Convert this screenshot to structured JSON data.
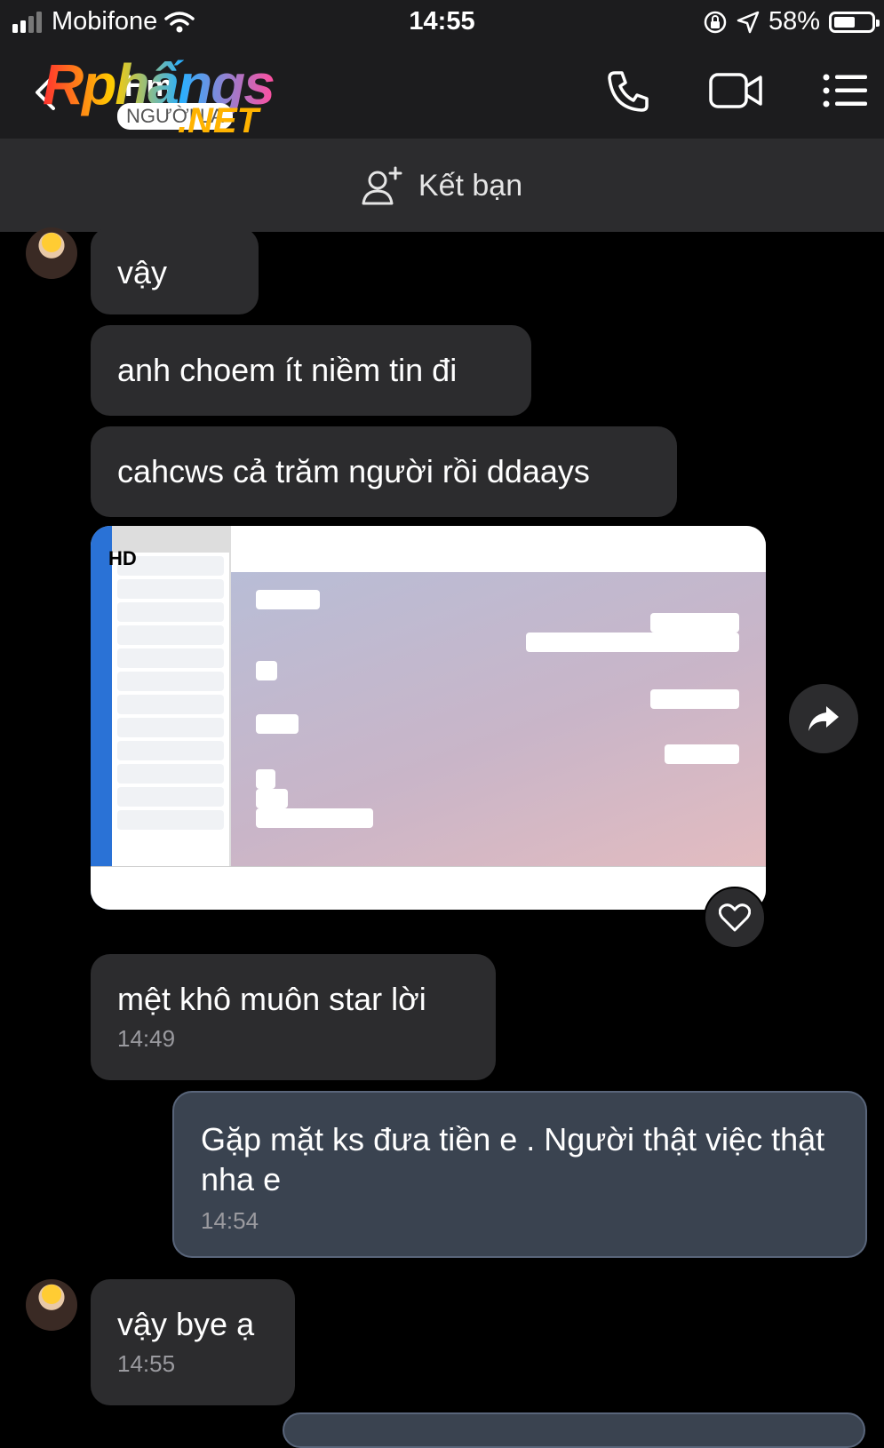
{
  "status_bar": {
    "carrier": "Mobifone",
    "time": "14:55",
    "battery_percent": "58%",
    "battery_level": 0.58
  },
  "header": {
    "contact_name": "Hm",
    "logo": {
      "main": "Rphấngs",
      "sub": "NGƯỜI LẠ",
      "net": ".NET"
    },
    "icons": [
      "back-icon",
      "phone-icon",
      "video-call-icon",
      "menu-icon"
    ]
  },
  "friend_bar": {
    "label": "Kết bạn",
    "icon": "add-friend-icon"
  },
  "messages": [
    {
      "text": "vậy",
      "time": ""
    },
    {
      "text": "anh choem ít niềm tin đi",
      "time": ""
    },
    {
      "text": "cahcws cả trăm người rồi ddaays",
      "time": ""
    },
    {
      "type": "image",
      "badge": "HD"
    },
    {
      "text": "mệt khô muôn star lời",
      "time": "14:49"
    },
    {
      "text": "Gặp mặt ks đưa tiền e . Người thật việc thật nha e",
      "time": "14:54",
      "mine": true
    },
    {
      "text": "vậy bye ạ",
      "time": "14:55"
    }
  ],
  "actions": {
    "share_icon": "share-icon",
    "like_icon": "heart-icon"
  }
}
